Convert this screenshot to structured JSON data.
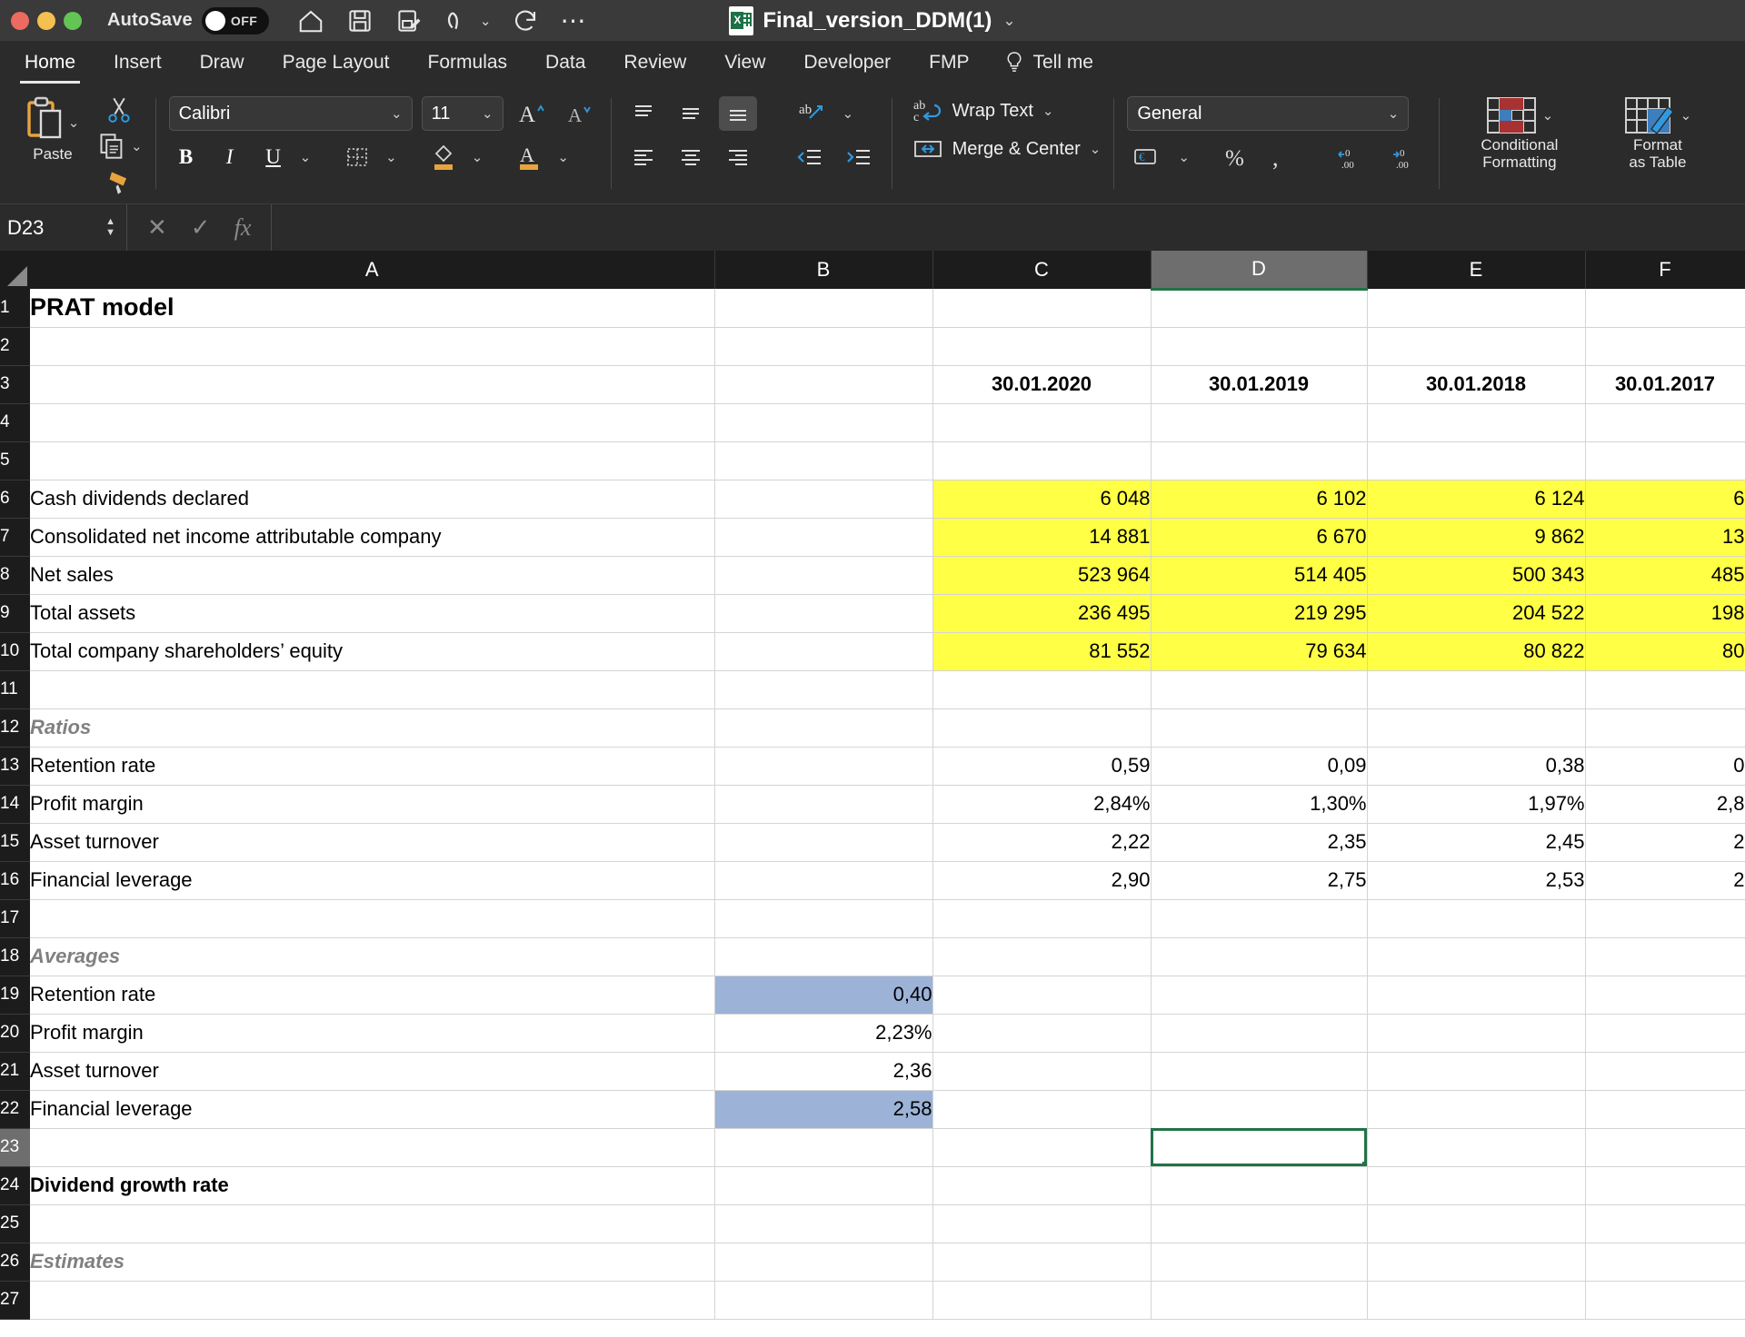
{
  "titlebar": {
    "autosave_label": "AutoSave",
    "autosave_state": "OFF",
    "document_title": "Final_version_DDM(1)",
    "icons": [
      "home-icon",
      "save-icon",
      "save-as-icon",
      "undo-icon",
      "redo-icon",
      "more-icon"
    ]
  },
  "ribbon": {
    "tabs": [
      {
        "label": "Home",
        "active": true
      },
      {
        "label": "Insert",
        "active": false
      },
      {
        "label": "Draw",
        "active": false
      },
      {
        "label": "Page Layout",
        "active": false
      },
      {
        "label": "Formulas",
        "active": false
      },
      {
        "label": "Data",
        "active": false
      },
      {
        "label": "Review",
        "active": false
      },
      {
        "label": "View",
        "active": false
      },
      {
        "label": "Developer",
        "active": false
      },
      {
        "label": "FMP",
        "active": false
      }
    ],
    "tell_me": "Tell me",
    "paste_label": "Paste",
    "font_name": "Calibri",
    "font_size": "11",
    "wrap_text": "Wrap Text",
    "merge_center": "Merge & Center",
    "number_format": "General",
    "conditional_formatting": "Conditional\nFormatting",
    "conditional_formatting_l1": "Conditional",
    "conditional_formatting_l2": "Formatting",
    "format_as_table_l1": "Format",
    "format_as_table_l2": "as Table"
  },
  "formula_bar": {
    "name_box": "D23",
    "formula": "",
    "cancel_icon": "close-icon",
    "confirm_icon": "check-icon",
    "function_icon": "fx-icon"
  },
  "sheet": {
    "columns": [
      "A",
      "B",
      "C",
      "D",
      "E",
      "F"
    ],
    "selected_column": "D",
    "selected_cell": "D23",
    "rows": [
      {
        "n": "1",
        "A": "PRAT model",
        "style_A": "big",
        "B": "",
        "C": "",
        "D": "",
        "E": "",
        "F": ""
      },
      {
        "n": "2",
        "A": "",
        "B": "",
        "C": "",
        "D": "",
        "E": "",
        "F": ""
      },
      {
        "n": "3",
        "A": "",
        "B": "",
        "C": "30.01.2020",
        "D": "30.01.2019",
        "E": "30.01.2018",
        "F": "30.01.2017",
        "style_vals": "hdr"
      },
      {
        "n": "4",
        "A": "",
        "B": "",
        "C": "",
        "D": "",
        "E": "",
        "F": ""
      },
      {
        "n": "5",
        "A": "",
        "B": "",
        "C": "",
        "D": "",
        "E": "",
        "F": ""
      },
      {
        "n": "6",
        "A": "Cash dividends declared",
        "B": "",
        "C": "6 048",
        "D": "6 102",
        "E": "6 124",
        "F": "6",
        "style_vals": "num yellow"
      },
      {
        "n": "7",
        "A": "Consolidated net income attributable company",
        "B": "",
        "C": "14 881",
        "D": "6 670",
        "E": "9 862",
        "F": "13",
        "style_vals": "num yellow"
      },
      {
        "n": "8",
        "A": "Net sales",
        "B": "",
        "C": "523 964",
        "D": "514 405",
        "E": "500 343",
        "F": "485",
        "style_vals": "num yellow"
      },
      {
        "n": "9",
        "A": "Total assets",
        "B": "",
        "C": "236 495",
        "D": "219 295",
        "E": "204 522",
        "F": "198",
        "style_vals": "num yellow"
      },
      {
        "n": "10",
        "A": "Total company shareholders’ equity",
        "B": "",
        "C": "81 552",
        "D": "79 634",
        "E": "80 822",
        "F": "80",
        "style_vals": "num yellow"
      },
      {
        "n": "11",
        "A": "",
        "B": "",
        "C": "",
        "D": "",
        "E": "",
        "F": ""
      },
      {
        "n": "12",
        "A": "Ratios",
        "style_A": "sec",
        "B": "",
        "C": "",
        "D": "",
        "E": "",
        "F": ""
      },
      {
        "n": "13",
        "A": "Retention rate",
        "B": "",
        "C": "0,59",
        "D": "0,09",
        "E": "0,38",
        "F": "0",
        "style_vals": "num"
      },
      {
        "n": "14",
        "A": "Profit margin",
        "B": "",
        "C": "2,84%",
        "D": "1,30%",
        "E": "1,97%",
        "F": "2,8",
        "style_vals": "num"
      },
      {
        "n": "15",
        "A": "Asset turnover",
        "B": "",
        "C": "2,22",
        "D": "2,35",
        "E": "2,45",
        "F": "2",
        "style_vals": "num"
      },
      {
        "n": "16",
        "A": "Financial leverage",
        "B": "",
        "C": "2,90",
        "D": "2,75",
        "E": "2,53",
        "F": "2",
        "style_vals": "num"
      },
      {
        "n": "17",
        "A": "",
        "B": "",
        "C": "",
        "D": "",
        "E": "",
        "F": ""
      },
      {
        "n": "18",
        "A": "Averages",
        "style_A": "sec",
        "B": "",
        "C": "",
        "D": "",
        "E": "",
        "F": ""
      },
      {
        "n": "19",
        "A": "Retention rate",
        "B": "0,40",
        "style_B": "num blue",
        "C": "",
        "D": "",
        "E": "",
        "F": ""
      },
      {
        "n": "20",
        "A": "Profit margin",
        "B": "2,23%",
        "style_B": "num",
        "C": "",
        "D": "",
        "E": "",
        "F": ""
      },
      {
        "n": "21",
        "A": "Asset turnover",
        "B": "2,36",
        "style_B": "num",
        "C": "",
        "D": "",
        "E": "",
        "F": ""
      },
      {
        "n": "22",
        "A": "Financial leverage",
        "B": "2,58",
        "style_B": "num blue",
        "C": "",
        "D": "",
        "E": "",
        "F": ""
      },
      {
        "n": "23",
        "A": "",
        "B": "",
        "C": "",
        "D": "",
        "E": "",
        "F": "",
        "selected": "D"
      },
      {
        "n": "24",
        "A": "Dividend growth rate",
        "style_A": "bold",
        "B": "",
        "C": "",
        "D": "",
        "E": "",
        "F": ""
      },
      {
        "n": "25",
        "A": "",
        "B": "",
        "C": "",
        "D": "",
        "E": "",
        "F": ""
      },
      {
        "n": "26",
        "A": "Estimates",
        "style_A": "sec",
        "B": "",
        "C": "",
        "D": "",
        "E": "",
        "F": ""
      },
      {
        "n": "27",
        "A": "",
        "B": "",
        "C": "",
        "D": "",
        "E": "",
        "F": ""
      }
    ]
  },
  "colors": {
    "highlight_yellow": "#ffff46",
    "highlight_blue": "#9cb3d7",
    "selection_green": "#217346",
    "chrome_dark": "#2b2b2b"
  }
}
